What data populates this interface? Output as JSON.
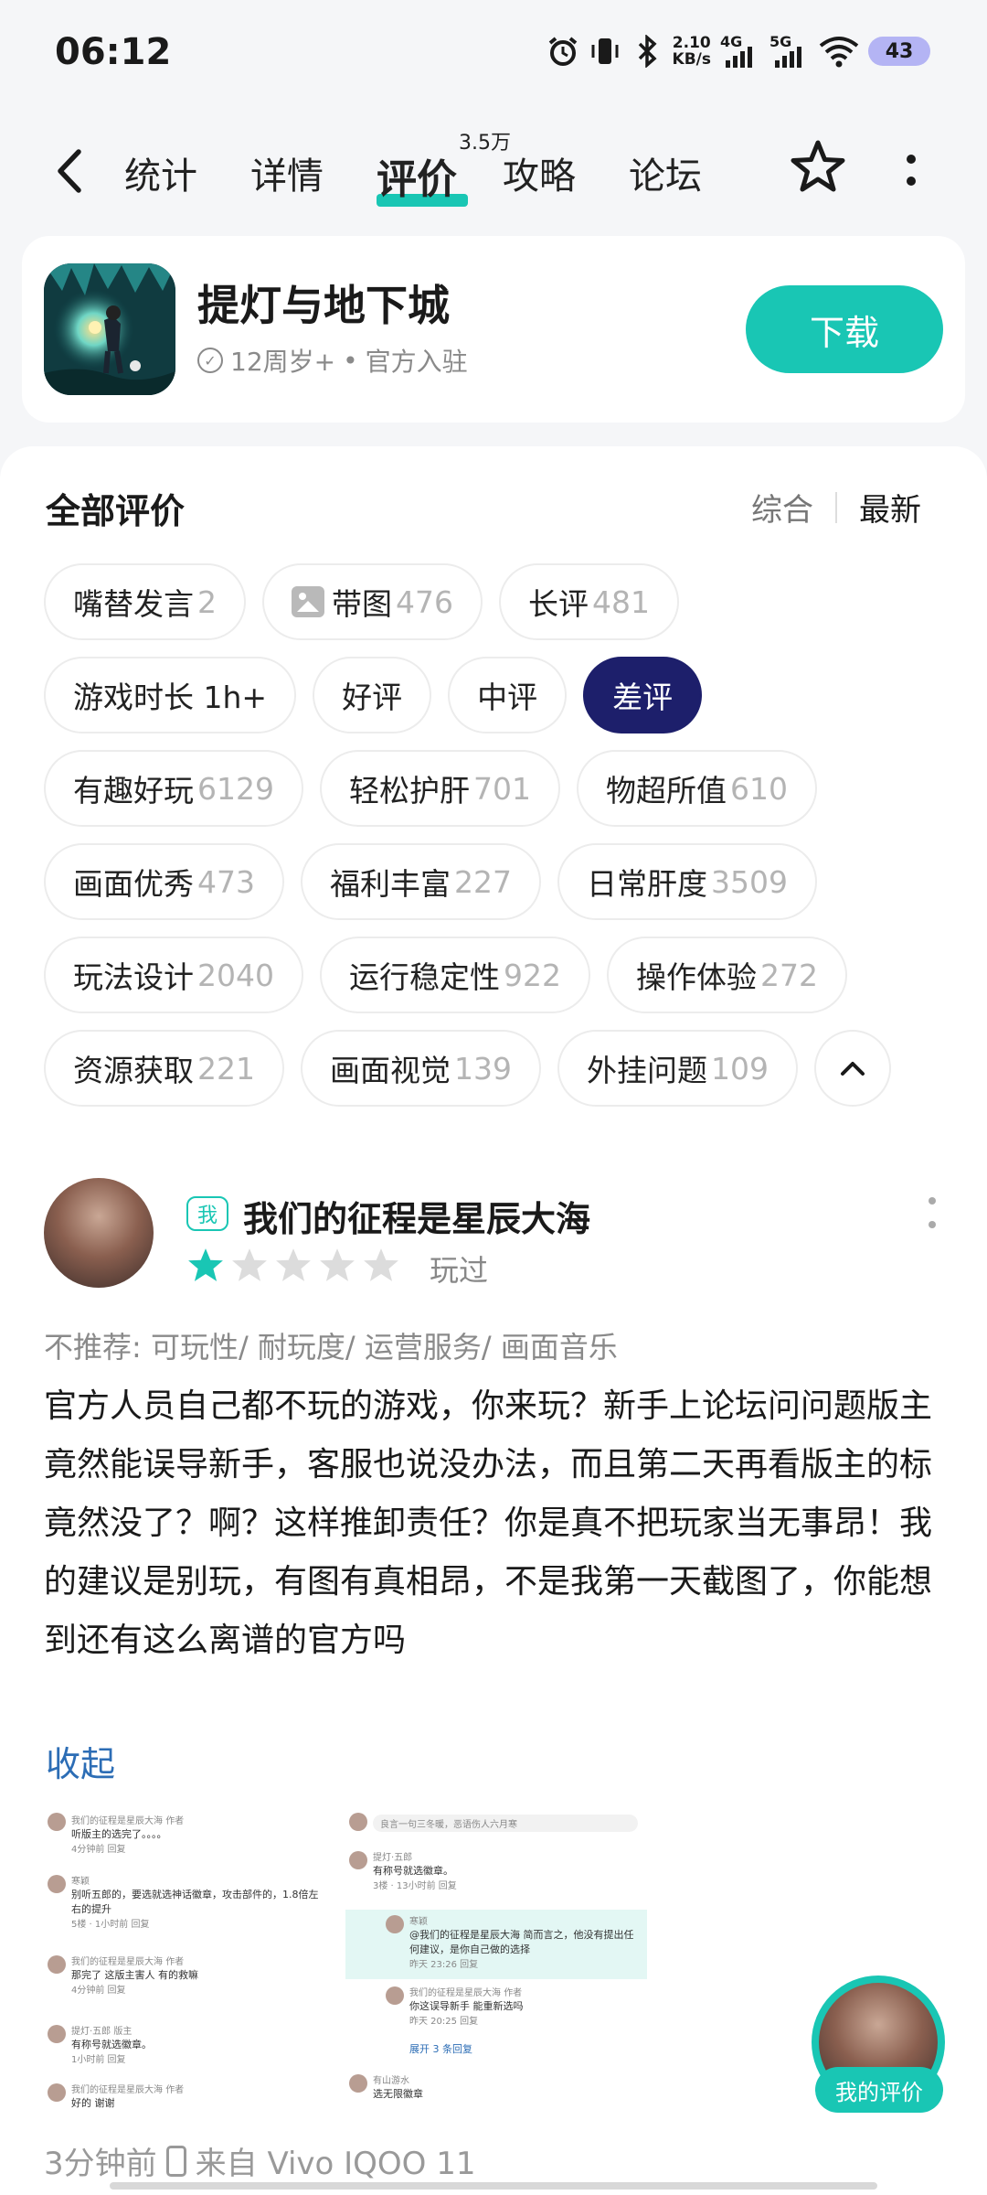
{
  "status_bar": {
    "time": "06:12",
    "speed_value": "2.10",
    "speed_unit": "KB/s",
    "net1": "4G",
    "net2": "5G",
    "battery": "43"
  },
  "nav": {
    "tabs": [
      {
        "label": "统计"
      },
      {
        "label": "详情"
      },
      {
        "label": "评价"
      },
      {
        "label": "攻略"
      },
      {
        "label": "论坛"
      }
    ],
    "review_count_badge": "3.5万",
    "active_tab": "评价"
  },
  "app": {
    "name": "提灯与地下城",
    "age": "12周岁+",
    "official": "官方入驻",
    "meta_sep": "•",
    "download_label": "下载",
    "accent_color": "#19c6b4"
  },
  "reviews": {
    "title": "全部评价",
    "sort_options": [
      "综合",
      "最新"
    ],
    "chips": [
      [
        {
          "label": "嘴替发言",
          "count": "2"
        },
        {
          "label": "带图",
          "count": "476",
          "icon": "image-icon"
        },
        {
          "label": "长评",
          "count": "481"
        }
      ],
      [
        {
          "label": "游戏时长 1h+",
          "count": ""
        },
        {
          "label": "好评",
          "count": ""
        },
        {
          "label": "中评",
          "count": ""
        },
        {
          "label": "差评",
          "count": "",
          "active": true
        }
      ],
      [
        {
          "label": "有趣好玩",
          "count": "6129"
        },
        {
          "label": "轻松护肝",
          "count": "701"
        },
        {
          "label": "物超所值",
          "count": "610"
        }
      ],
      [
        {
          "label": "画面优秀",
          "count": "473"
        },
        {
          "label": "福利丰富",
          "count": "227"
        },
        {
          "label": "日常肝度",
          "count": "3509"
        }
      ],
      [
        {
          "label": "玩法设计",
          "count": "2040"
        },
        {
          "label": "运行稳定性",
          "count": "922"
        },
        {
          "label": "操作体验",
          "count": "272"
        }
      ],
      [
        {
          "label": "资源获取",
          "count": "221"
        },
        {
          "label": "画面视觉",
          "count": "139"
        },
        {
          "label": "外挂问题",
          "count": "109"
        }
      ]
    ]
  },
  "review": {
    "me_badge": "我",
    "username": "我们的征程是星辰大海",
    "rating": 1,
    "rating_max": 5,
    "played": "玩过",
    "not_recommend": "不推荐: 可玩性/ 耐玩度/ 运营服务/ 画面音乐",
    "text": "官方人员自己都不玩的游戏，你来玩？新手上论坛问问题版主竟然能误导新手，客服也说没办法，而且第二天再看版主的标竟然没了？啊？这样推卸责任？你是真不把玩家当无事昂！我的建议是别玩，有图有真相昂，不是我第一天截图了，你能想到还有这么离谱的官方吗",
    "collapse": "收起",
    "time": "3分钟前",
    "device": "来自 Vivo IQOO 11",
    "screenshot1": [
      {
        "name": "我们的征程是星辰大海",
        "tag": "作者",
        "text": "听版主的选完了。。。。",
        "meta": "4分钟前  回复"
      },
      {
        "name": "寒颖",
        "tag": "",
        "text": "别听五郎的，要选就选神话徽章，攻击部件的，1.8倍左右的提升",
        "meta": "5楼 · 1小时前  回复"
      },
      {
        "name": "我们的征程是星辰大海",
        "tag": "作者",
        "text": "那完了 这版主害人 有的救嘛",
        "meta": "4分钟前  回复"
      },
      {
        "name": "提灯·五郎",
        "tag": "版主",
        "text": "有称号就选徽章。",
        "meta": "1小时前  回复"
      },
      {
        "name": "我们的征程是星辰大海",
        "tag": "作者",
        "text": "好的 谢谢",
        "meta": ""
      }
    ],
    "screenshot2": [
      {
        "name": "",
        "tag": "",
        "text": "良言一句三冬暖，恶语伤人六月寒",
        "meta": ""
      },
      {
        "name": "提灯·五郎",
        "tag": "",
        "text": "有称号就选徽章。",
        "meta": "3楼 · 13小时前  回复"
      },
      {
        "name": "寒颖",
        "tag": "",
        "text": "@我们的征程是星辰大海  简而言之，他没有提出任何建议，是你自己做的选择",
        "meta": "昨天 23:26  回复"
      },
      {
        "name": "我们的征程是星辰大海",
        "tag": "作者",
        "text": "你这误导新手  能重新选吗",
        "meta": "昨天 20:25  回复"
      },
      {
        "name": "",
        "tag": "",
        "text": "展开 3 条回复",
        "meta": ""
      },
      {
        "name": "有山游水",
        "tag": "",
        "text": "选无限徽章",
        "meta": ""
      }
    ]
  },
  "floating": {
    "label": "我的评价"
  }
}
